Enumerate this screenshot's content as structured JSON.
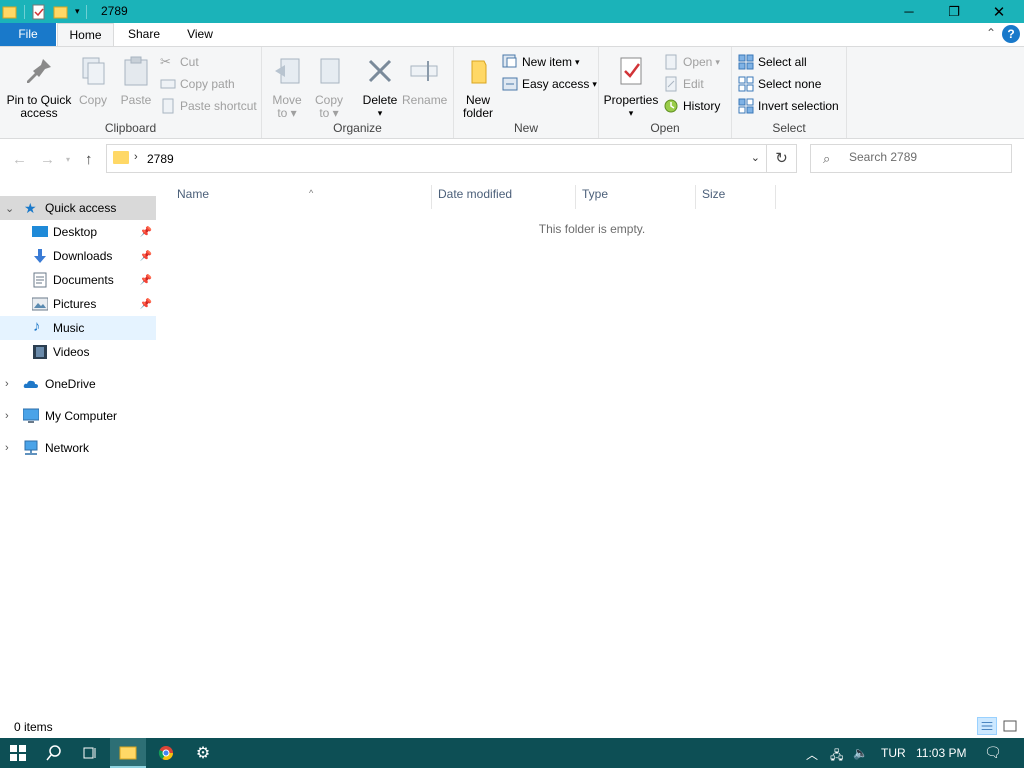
{
  "window": {
    "title": "2789",
    "controls": {
      "minimize": "─",
      "maximize": "❐",
      "close": "✕"
    }
  },
  "ribbon_tabs": {
    "file": "File",
    "home": "Home",
    "share": "Share",
    "view": "View"
  },
  "ribbon": {
    "clipboard": {
      "label": "Clipboard",
      "pin": "Pin to Quick access",
      "pin_l1": "Pin to Quick",
      "pin_l2": "access",
      "copy": "Copy",
      "paste": "Paste",
      "cut": "Cut",
      "copy_path": "Copy path",
      "paste_shortcut": "Paste shortcut"
    },
    "organize": {
      "label": "Organize",
      "move_l1": "Move",
      "move_l2": "to",
      "copy_l1": "Copy",
      "copy_l2": "to",
      "delete": "Delete",
      "rename": "Rename"
    },
    "new": {
      "label": "New",
      "new_folder_l1": "New",
      "new_folder_l2": "folder",
      "new_item": "New item",
      "easy_access": "Easy access"
    },
    "open": {
      "label": "Open",
      "properties": "Properties",
      "open": "Open",
      "edit": "Edit",
      "history": "History"
    },
    "select": {
      "label": "Select",
      "select_all": "Select all",
      "select_none": "Select none",
      "invert": "Invert selection"
    }
  },
  "address": {
    "path": "2789",
    "search_placeholder": "Search 2789"
  },
  "nav_pane": {
    "quick_access": "Quick access",
    "items": [
      {
        "label": "Desktop",
        "icon": "desktop-icon"
      },
      {
        "label": "Downloads",
        "icon": "downloads-icon"
      },
      {
        "label": "Documents",
        "icon": "documents-icon"
      },
      {
        "label": "Pictures",
        "icon": "pictures-icon"
      },
      {
        "label": "Music",
        "icon": "music-icon"
      },
      {
        "label": "Videos",
        "icon": "videos-icon"
      }
    ],
    "onedrive": "OneDrive",
    "my_computer": "My Computer",
    "network": "Network"
  },
  "columns": {
    "name": "Name",
    "date_modified": "Date modified",
    "type": "Type",
    "size": "Size"
  },
  "empty_message": "This folder is empty.",
  "status": {
    "item_count": "0 items"
  },
  "taskbar": {
    "language": "TUR",
    "time": "11:03 PM"
  },
  "colors": {
    "titlebar": "#1bb3b9",
    "file_tab": "#1979ca",
    "taskbar": "#0d4f55",
    "selected": "#cce8ff"
  }
}
